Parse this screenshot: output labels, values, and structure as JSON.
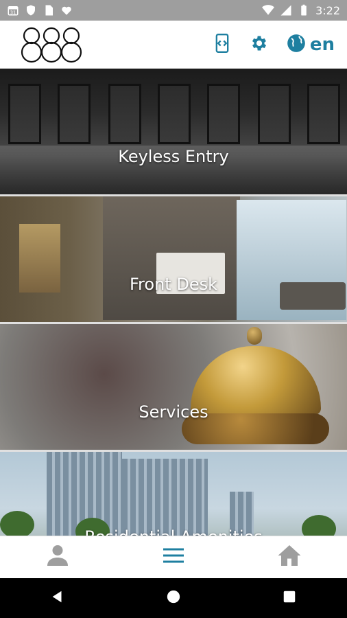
{
  "status_bar": {
    "time": "3:22",
    "calendar_day": "31"
  },
  "header": {
    "logo_text": "888",
    "language": "en",
    "accent_color": "#1e7fa0"
  },
  "tiles": [
    {
      "label": "Keyless Entry"
    },
    {
      "label": "Front Desk"
    },
    {
      "label": "Services"
    },
    {
      "label": "Residential Amenities"
    }
  ],
  "bottom_nav": {
    "items": [
      {
        "icon": "person-icon"
      },
      {
        "icon": "menu-icon"
      },
      {
        "icon": "home-icon"
      }
    ]
  },
  "system_nav": {
    "items": [
      {
        "icon": "back-icon"
      },
      {
        "icon": "home-circle-icon"
      },
      {
        "icon": "recents-icon"
      }
    ]
  }
}
